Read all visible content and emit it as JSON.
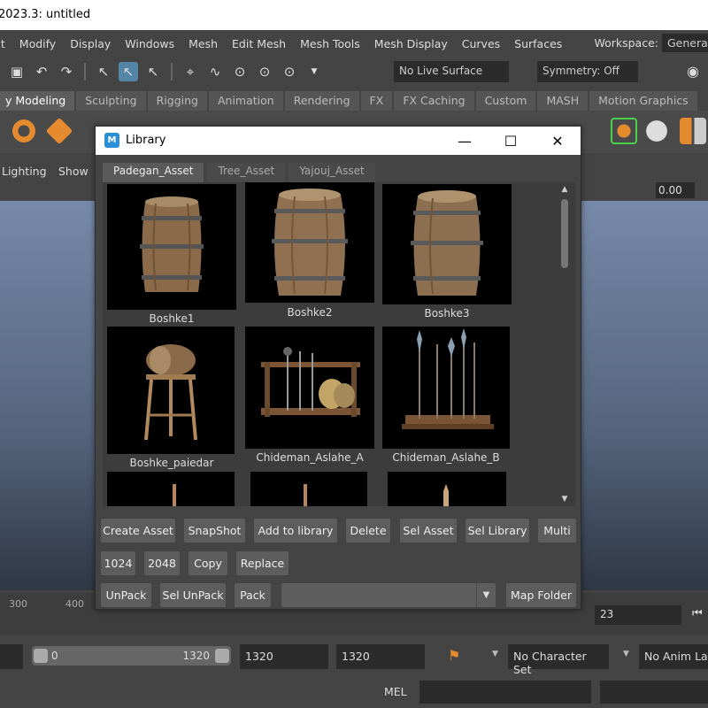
{
  "app": {
    "title": "2023.3: untitled"
  },
  "menu": [
    "ct",
    "Modify",
    "Display",
    "Windows",
    "Mesh",
    "Edit Mesh",
    "Mesh Tools",
    "Mesh Display",
    "Curves",
    "Surfaces"
  ],
  "workspace": {
    "label": "Workspace:",
    "value": "General"
  },
  "status_line": {
    "live_surface": "No Live Surface",
    "symmetry": "Symmetry: Off"
  },
  "shelf_tabs": [
    "y Modeling",
    "Sculpting",
    "Rigging",
    "Animation",
    "Rendering",
    "FX",
    "FX Caching",
    "Custom",
    "MASH",
    "Motion Graphics"
  ],
  "panel_menu": {
    "lighting": "Lighting",
    "show": "Show",
    "value": "0.00"
  },
  "library": {
    "title": "Library",
    "tabs": [
      "Padegan_Asset",
      "Tree_Asset",
      "Yajouj_Asset"
    ],
    "assets": [
      {
        "name": "Boshke1",
        "icon": "barrel-thumbnail"
      },
      {
        "name": "Boshke2",
        "icon": "barrel-thumbnail"
      },
      {
        "name": "Boshke3",
        "icon": "barrel-thumbnail"
      },
      {
        "name": "Boshke_paiedar",
        "icon": "barrel-stand-thumbnail"
      },
      {
        "name": "Chideman_Aslahe_A",
        "icon": "weapon-rack-thumbnail"
      },
      {
        "name": "Chideman_Aslahe_B",
        "icon": "spear-rack-thumbnail"
      }
    ],
    "buttons_row1": [
      "Create Asset",
      "SnapShot",
      "Add to library",
      "Delete",
      "Sel Asset",
      "Sel Library",
      "Multi"
    ],
    "buttons_row2": [
      "1024",
      "2048",
      "Copy",
      "Replace"
    ],
    "buttons_row3": [
      "UnPack",
      "Sel UnPack",
      "Pack"
    ],
    "combo_value": "",
    "map_folder": "Map Folder"
  },
  "time_slider": {
    "ticks": [
      "300",
      "400"
    ],
    "current_frame": "23"
  },
  "range": {
    "start": "0",
    "end": "1320",
    "field_a": "1320",
    "field_b": "1320",
    "character_set": "No Character Set",
    "anim_layer": "No Anim Lay"
  },
  "command_line": {
    "lang": "MEL"
  }
}
